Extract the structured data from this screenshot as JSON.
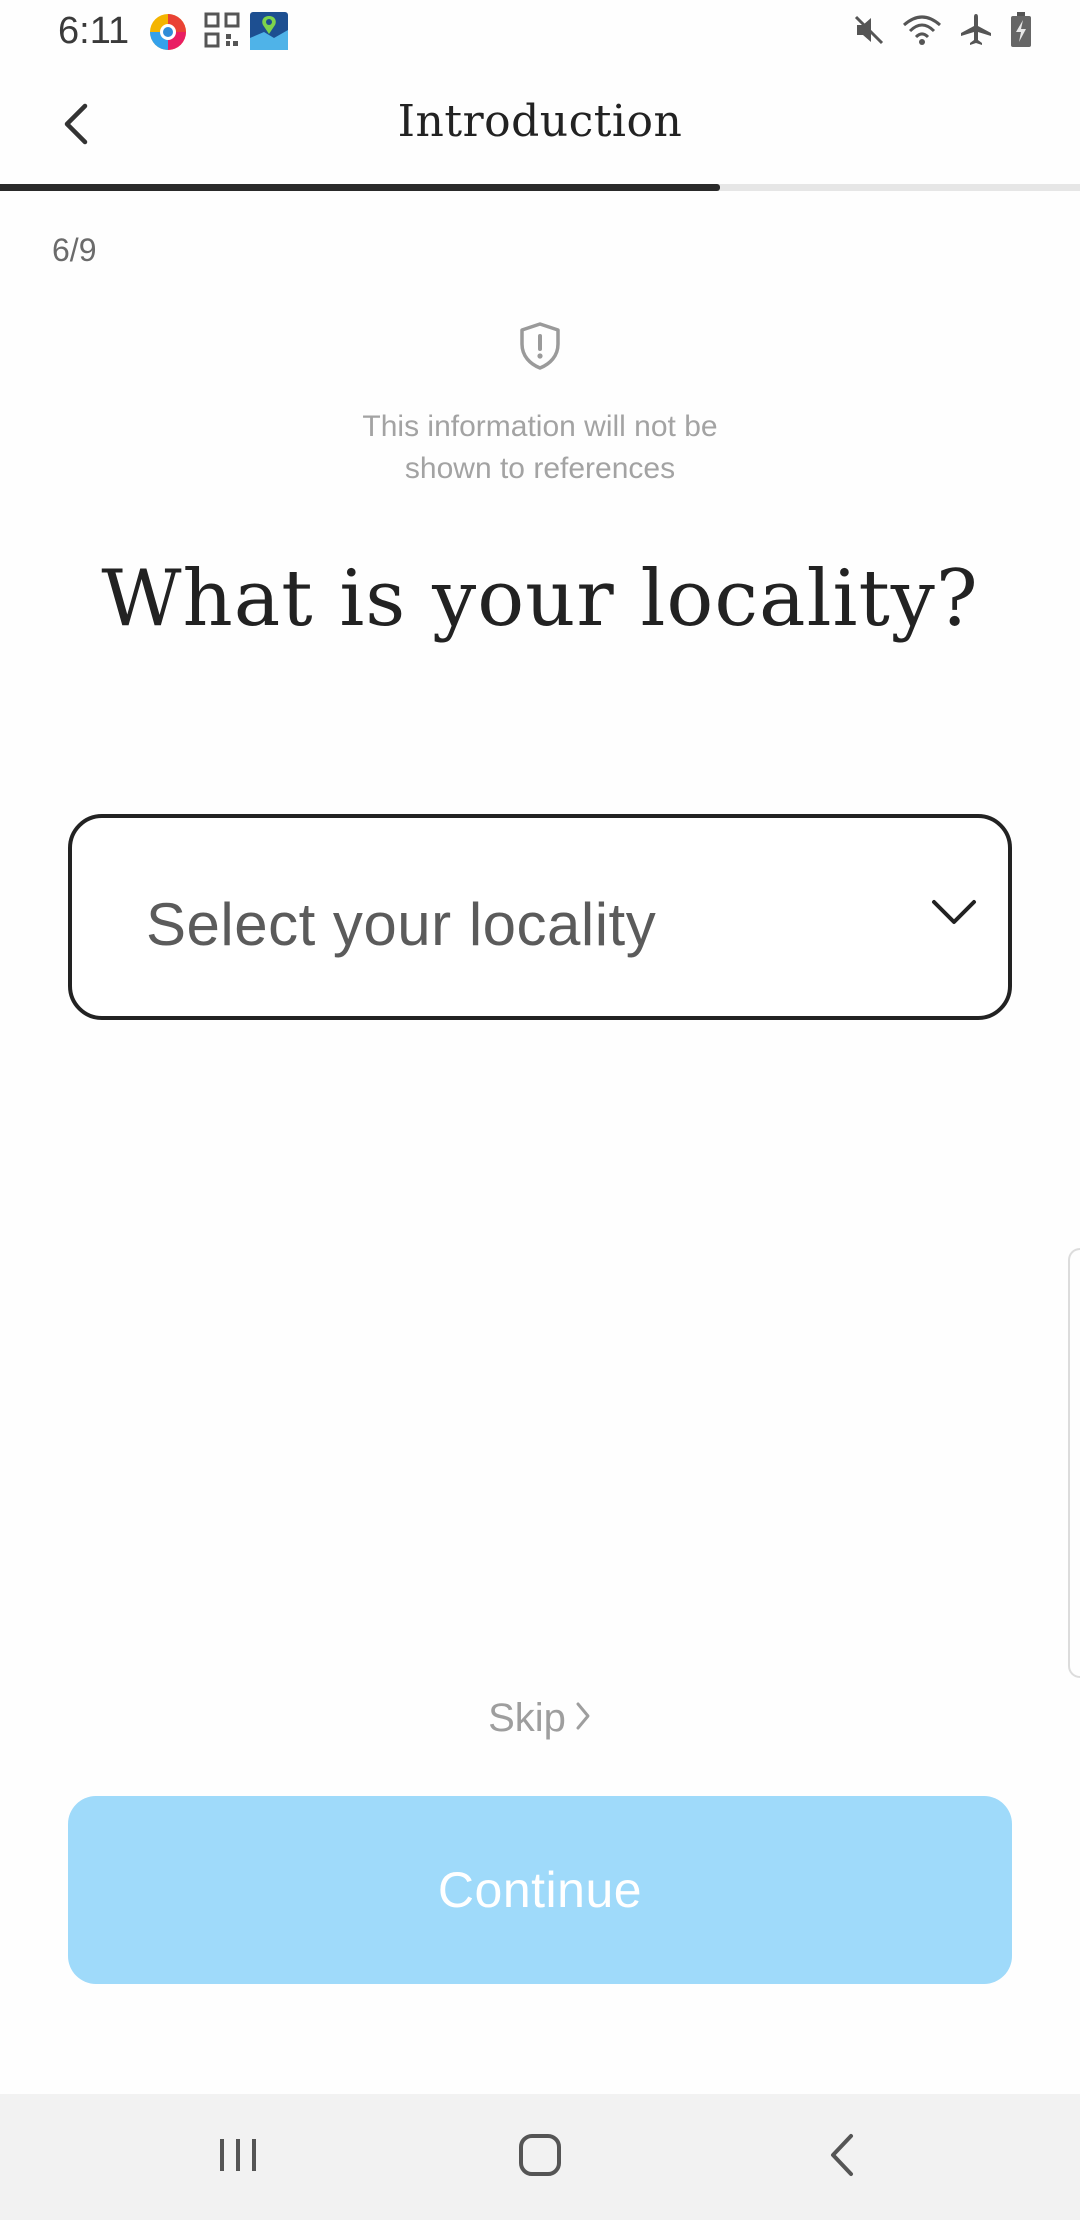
{
  "status_bar": {
    "time": "6:11",
    "icons": [
      "chrome-like-icon",
      "qr-code-icon",
      "maps-icon",
      "mute-icon",
      "wifi-icon",
      "airplane-mode-icon",
      "battery-charging-icon"
    ]
  },
  "header": {
    "title": "Introduction",
    "back_icon": "chevron-left-icon"
  },
  "progress": {
    "current_step": 6,
    "total_steps": 9,
    "label": "6/9",
    "fraction": 0.667
  },
  "privacy": {
    "icon": "shield-exclamation-icon",
    "line1": "This information will not be",
    "line2": "shown to references"
  },
  "question": {
    "text": "What is your locality?"
  },
  "locality_select": {
    "placeholder": "Select your locality",
    "selected_value": "",
    "icon": "chevron-down-icon"
  },
  "actions": {
    "skip_label": "Skip",
    "continue_label": "Continue"
  },
  "colors": {
    "accent_disabled": "#9fdafa",
    "text_primary": "#222222",
    "text_muted": "#a3a3a3"
  },
  "nav_bar": {
    "buttons": [
      "recents-icon",
      "home-icon",
      "back-icon"
    ]
  }
}
